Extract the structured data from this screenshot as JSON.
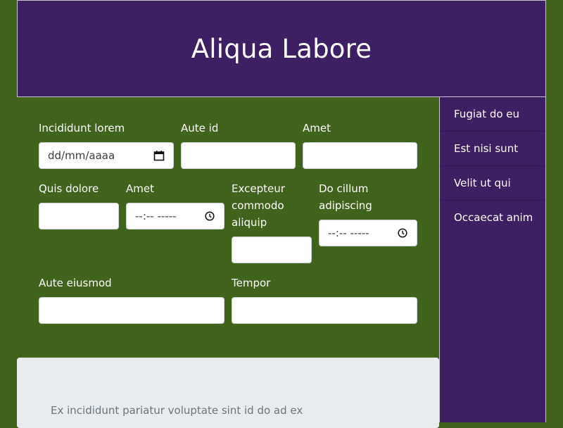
{
  "header": {
    "title": "Aliqua Labore"
  },
  "sidebar": {
    "items": [
      {
        "label": "Fugiat do eu"
      },
      {
        "label": "Est nisi sunt"
      },
      {
        "label": "Velit ut qui"
      },
      {
        "label": "Occaecat anim"
      }
    ]
  },
  "form": {
    "row1": {
      "incididunt": {
        "label": "Incididunt lorem",
        "placeholder": "dd/mm/aaaa"
      },
      "aute_id": {
        "label": "Aute id",
        "value": ""
      },
      "amet": {
        "label": "Amet",
        "value": ""
      }
    },
    "row2": {
      "quis": {
        "label": "Quis dolore",
        "value": ""
      },
      "amet_time": {
        "label": "Amet",
        "placeholder": "--:-- -----"
      },
      "excepteur": {
        "label": "Excepteur commodo aliquip",
        "value": ""
      },
      "do_cillum": {
        "label": "Do cillum adipiscing",
        "placeholder": "--:-- -----"
      }
    },
    "row3": {
      "aute_eiusmod": {
        "label": "Aute eiusmod",
        "value": ""
      },
      "tempor": {
        "label": "Tempor",
        "value": ""
      }
    }
  },
  "card": {
    "text": "Ex incididunt pariatur voluptate sint id do ad ex"
  },
  "colors": {
    "background": "#41631c",
    "header": "#3d1f63",
    "sidebar": "#3d1f63",
    "card": "#e9ecef"
  }
}
